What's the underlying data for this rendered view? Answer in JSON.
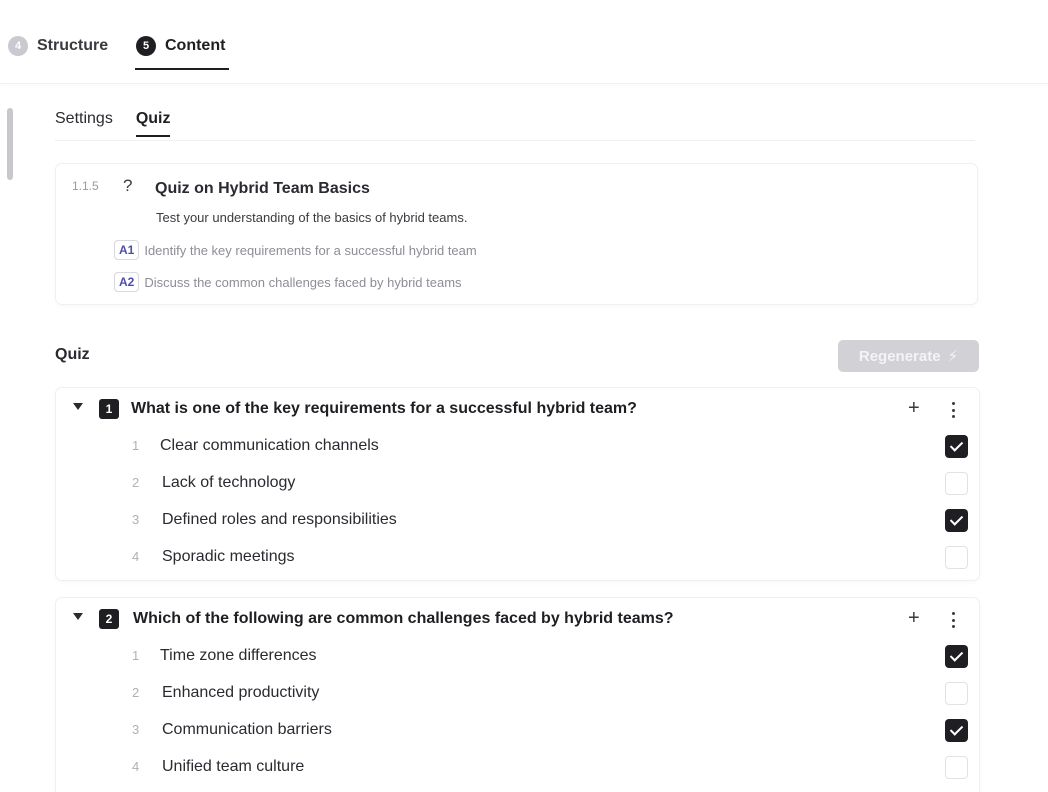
{
  "steps": [
    {
      "number": "4",
      "label": "Structure"
    },
    {
      "number": "5",
      "label": "Content"
    }
  ],
  "subtabs": [
    "Settings",
    "Quiz"
  ],
  "lesson": {
    "number": "1.1.5",
    "type_icon": "?",
    "title": "Quiz on Hybrid Team Basics",
    "description": "Test your understanding of the basics of hybrid teams.",
    "objectives": [
      {
        "badge": "A1",
        "text": "Identify the key requirements for a successful hybrid team"
      },
      {
        "badge": "A2",
        "text": "Discuss the common challenges faced by hybrid teams"
      }
    ]
  },
  "quiz": {
    "title": "Quiz",
    "regenerate_label": "Regenerate",
    "questions": [
      {
        "number": "1",
        "text": "What is one of the key requirements for a successful hybrid team?",
        "answers": [
          {
            "num": "1",
            "text": "Clear communication channels",
            "checked": true
          },
          {
            "num": "2",
            "text": "Lack of technology",
            "checked": false
          },
          {
            "num": "3",
            "text": "Defined roles and responsibilities",
            "checked": true
          },
          {
            "num": "4",
            "text": "Sporadic meetings",
            "checked": false
          }
        ]
      },
      {
        "number": "2",
        "text": "Which of the following are common challenges faced by hybrid teams?",
        "answers": [
          {
            "num": "1",
            "text": "Time zone differences",
            "checked": true
          },
          {
            "num": "2",
            "text": "Enhanced productivity",
            "checked": false
          },
          {
            "num": "3",
            "text": "Communication barriers",
            "checked": true
          },
          {
            "num": "4",
            "text": "Unified team culture",
            "checked": false
          }
        ]
      }
    ]
  }
}
